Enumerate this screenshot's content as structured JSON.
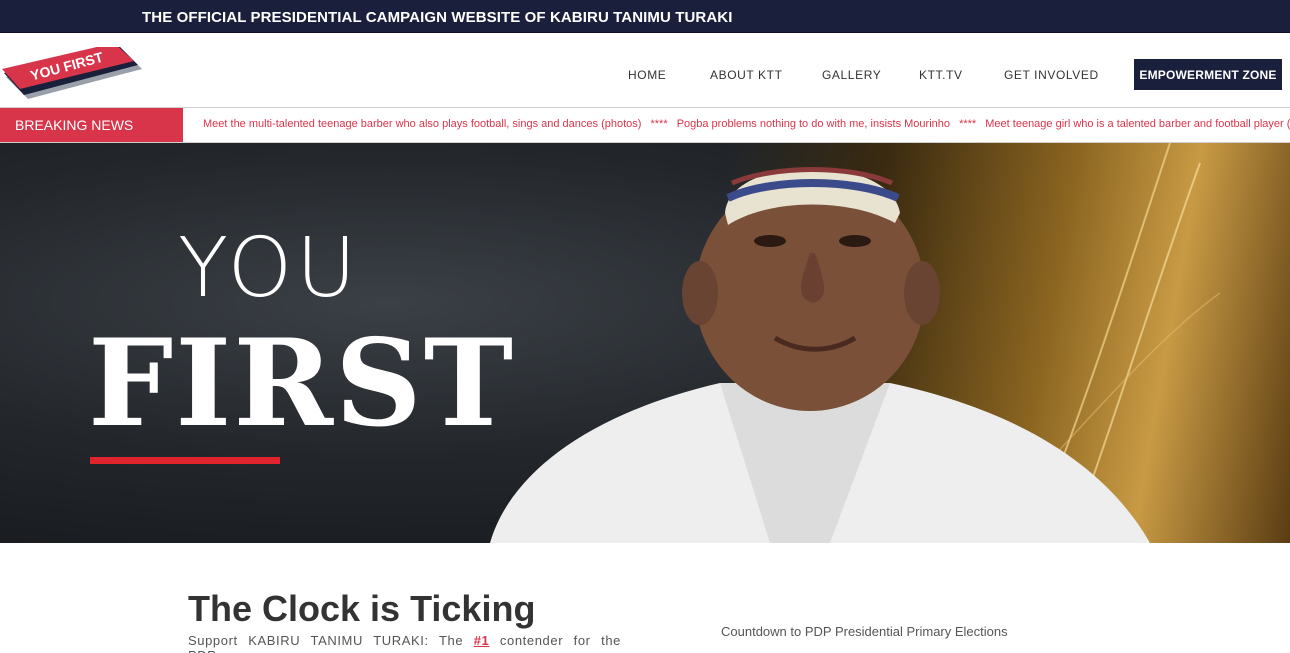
{
  "topbar": {
    "title": "THE OFFICIAL PRESIDENTIAL CAMPAIGN WEBSITE OF KABIRU TANIMU TURAKI"
  },
  "logo": {
    "text": "YOU FIRST"
  },
  "nav": {
    "items": [
      "HOME",
      "ABOUT KTT",
      "GALLERY",
      "KTT.TV",
      "GET INVOLVED"
    ],
    "cta": "EMPOWERMENT ZONE"
  },
  "breaking": {
    "label": "BREAKING NEWS",
    "separator": "****",
    "items": [
      "Meet the multi-talented teenage barber who also plays football, sings and dances (photos)",
      "Pogba problems nothing to do with me, insists Mourinho",
      "Meet teenage girl who is a talented barber and football player (pho"
    ]
  },
  "hero": {
    "line1": "YOU",
    "line2": "FIRST"
  },
  "section": {
    "title": "The Clock is Ticking",
    "text_before": "Support KABIRU TANIMU TURAKI: The",
    "highlight": "#1",
    "text_after": "contender for the PDP",
    "countdown": "Countdown to PDP Presidential Primary Elections"
  },
  "colors": {
    "navy": "#1a1f3c",
    "red": "#d9354a",
    "accent_red": "#e0242e"
  }
}
